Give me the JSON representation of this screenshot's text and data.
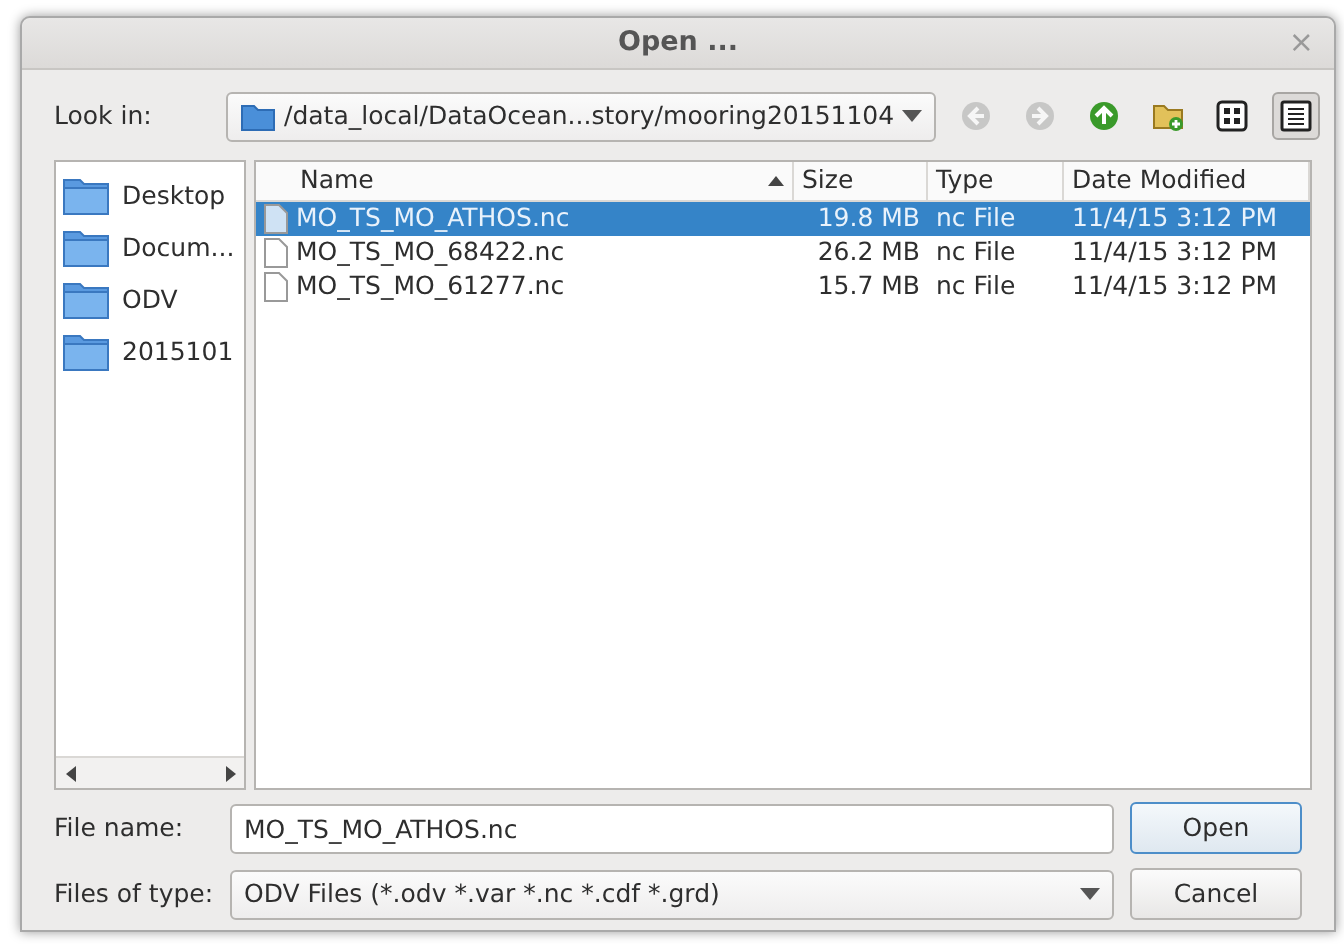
{
  "window": {
    "title": "Open ...",
    "close": "×"
  },
  "look_in": {
    "label": "Look in:",
    "path": "/data_local/DataOcean...story/mooring20151104"
  },
  "toolbar": [
    {
      "kind": "back",
      "disabled": true
    },
    {
      "kind": "forward",
      "disabled": true
    },
    {
      "kind": "up",
      "disabled": false
    },
    {
      "kind": "new-folder",
      "disabled": false
    },
    {
      "kind": "icon-view",
      "selected": false
    },
    {
      "kind": "detail-view",
      "selected": true
    }
  ],
  "sidebar": {
    "items": [
      {
        "label": "Desktop"
      },
      {
        "label": "Docum..."
      },
      {
        "label": "ODV"
      },
      {
        "label": "2015101"
      }
    ]
  },
  "table": {
    "columns": [
      {
        "label": "Name",
        "sorted": true
      },
      {
        "label": "Size",
        "sorted": false
      },
      {
        "label": "Type",
        "sorted": false
      },
      {
        "label": "Date Modified",
        "sorted": false
      }
    ],
    "rows": [
      {
        "name": "MO_TS_MO_ATHOS.nc",
        "size": "19.8 MB",
        "type": "nc File",
        "date": "11/4/15 3:12 PM",
        "selected": true
      },
      {
        "name": "MO_TS_MO_68422.nc",
        "size": "26.2 MB",
        "type": "nc File",
        "date": "11/4/15 3:12 PM",
        "selected": false
      },
      {
        "name": "MO_TS_MO_61277.nc",
        "size": "15.7 MB",
        "type": "nc File",
        "date": "11/4/15 3:12 PM",
        "selected": false
      }
    ]
  },
  "file_name": {
    "label": "File name:",
    "value": "MO_TS_MO_ATHOS.nc"
  },
  "file_type": {
    "label": "Files of type:",
    "value": "ODV Files (*.odv *.var *.nc *.cdf *.grd)"
  },
  "buttons": [
    {
      "label": "Open",
      "default": true
    },
    {
      "label": "Cancel",
      "default": false
    }
  ]
}
